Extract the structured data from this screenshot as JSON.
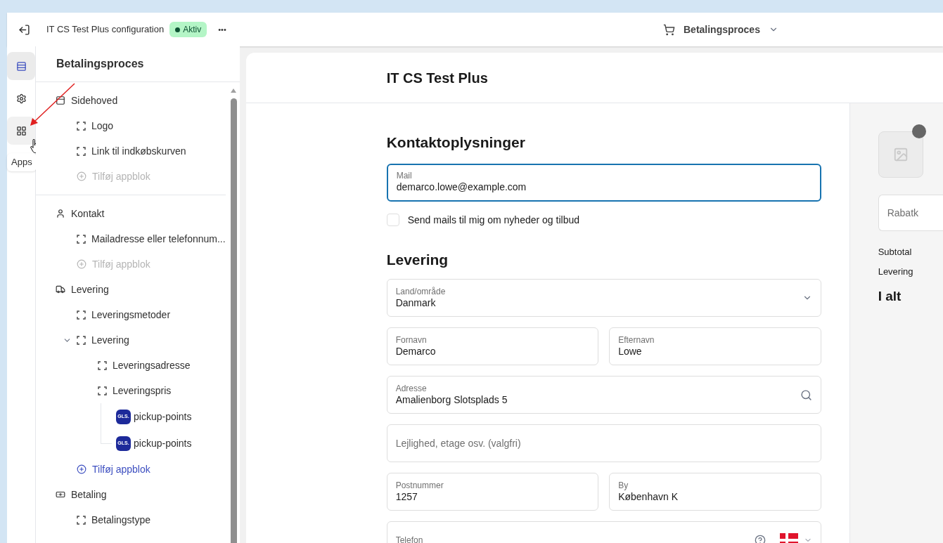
{
  "topbar": {
    "title": "IT CS Test Plus configuration",
    "status": "Aktiv",
    "more": "•••",
    "page_selector": "Betalingsproces"
  },
  "rail": [
    {
      "selected": true
    },
    {
      "selected": false
    },
    {
      "selected": false
    }
  ],
  "tooltip": "Apps",
  "sidebar": {
    "title": "Betalingsproces",
    "sections": [
      {
        "label": "Sidehoved",
        "children": [
          {
            "kind": "block",
            "label": "Logo"
          },
          {
            "kind": "block",
            "label": "Link til indkøbskurven"
          },
          {
            "kind": "add",
            "label": "Tilføj appblok",
            "disabled": true
          }
        ]
      },
      {
        "label": "Kontakt",
        "children": [
          {
            "kind": "block",
            "label": "Mailadresse eller telefonnum..."
          },
          {
            "kind": "add",
            "label": "Tilføj appblok",
            "disabled": true
          }
        ]
      },
      {
        "label": "Levering",
        "children": [
          {
            "kind": "block",
            "label": "Leveringsmetoder"
          },
          {
            "kind": "block",
            "label": "Levering",
            "expanded": true,
            "children": [
              {
                "kind": "block",
                "label": "Leveringsadresse"
              },
              {
                "kind": "block",
                "label": "Leveringspris",
                "children": [
                  {
                    "kind": "app",
                    "label": "pickup-points",
                    "badge": "GLS."
                  },
                  {
                    "kind": "app",
                    "label": "pickup-points",
                    "badge": "GLS."
                  }
                ]
              }
            ]
          },
          {
            "kind": "add",
            "label": "Tilføj appblok",
            "disabled": false
          }
        ]
      },
      {
        "label": "Betaling",
        "children": [
          {
            "kind": "block",
            "label": "Betalingstype"
          }
        ]
      }
    ]
  },
  "preview": {
    "shop_name": "IT CS Test Plus",
    "contact": {
      "heading": "Kontaktoplysninger",
      "email": {
        "label": "Mail",
        "value": "demarco.lowe@example.com",
        "focused": true
      },
      "newsletter": {
        "label": "Send mails til mig om nyheder og tilbud",
        "checked": false
      }
    },
    "delivery": {
      "heading": "Levering",
      "rows": [
        [
          {
            "kind": "select",
            "label": "Land/område",
            "value": "Danmark"
          }
        ],
        [
          {
            "kind": "text",
            "label": "Fornavn",
            "value": "Demarco"
          },
          {
            "kind": "text",
            "label": "Efternavn",
            "value": "Lowe"
          }
        ],
        [
          {
            "kind": "search",
            "label": "Adresse",
            "value": "Amalienborg Slotsplads 5"
          }
        ],
        [
          {
            "kind": "empty",
            "placeholder": "Lejlighed, etage osv. (valgfri)"
          }
        ],
        [
          {
            "kind": "text",
            "label": "Postnummer",
            "value": "1257"
          },
          {
            "kind": "text",
            "label": "By",
            "value": "København K"
          }
        ],
        [
          {
            "kind": "phone",
            "label": "Telefon"
          }
        ]
      ]
    },
    "summary": {
      "discount_placeholder": "Rabatk",
      "lines": [
        "Subtotal",
        "Levering"
      ],
      "total": "I alt"
    }
  }
}
